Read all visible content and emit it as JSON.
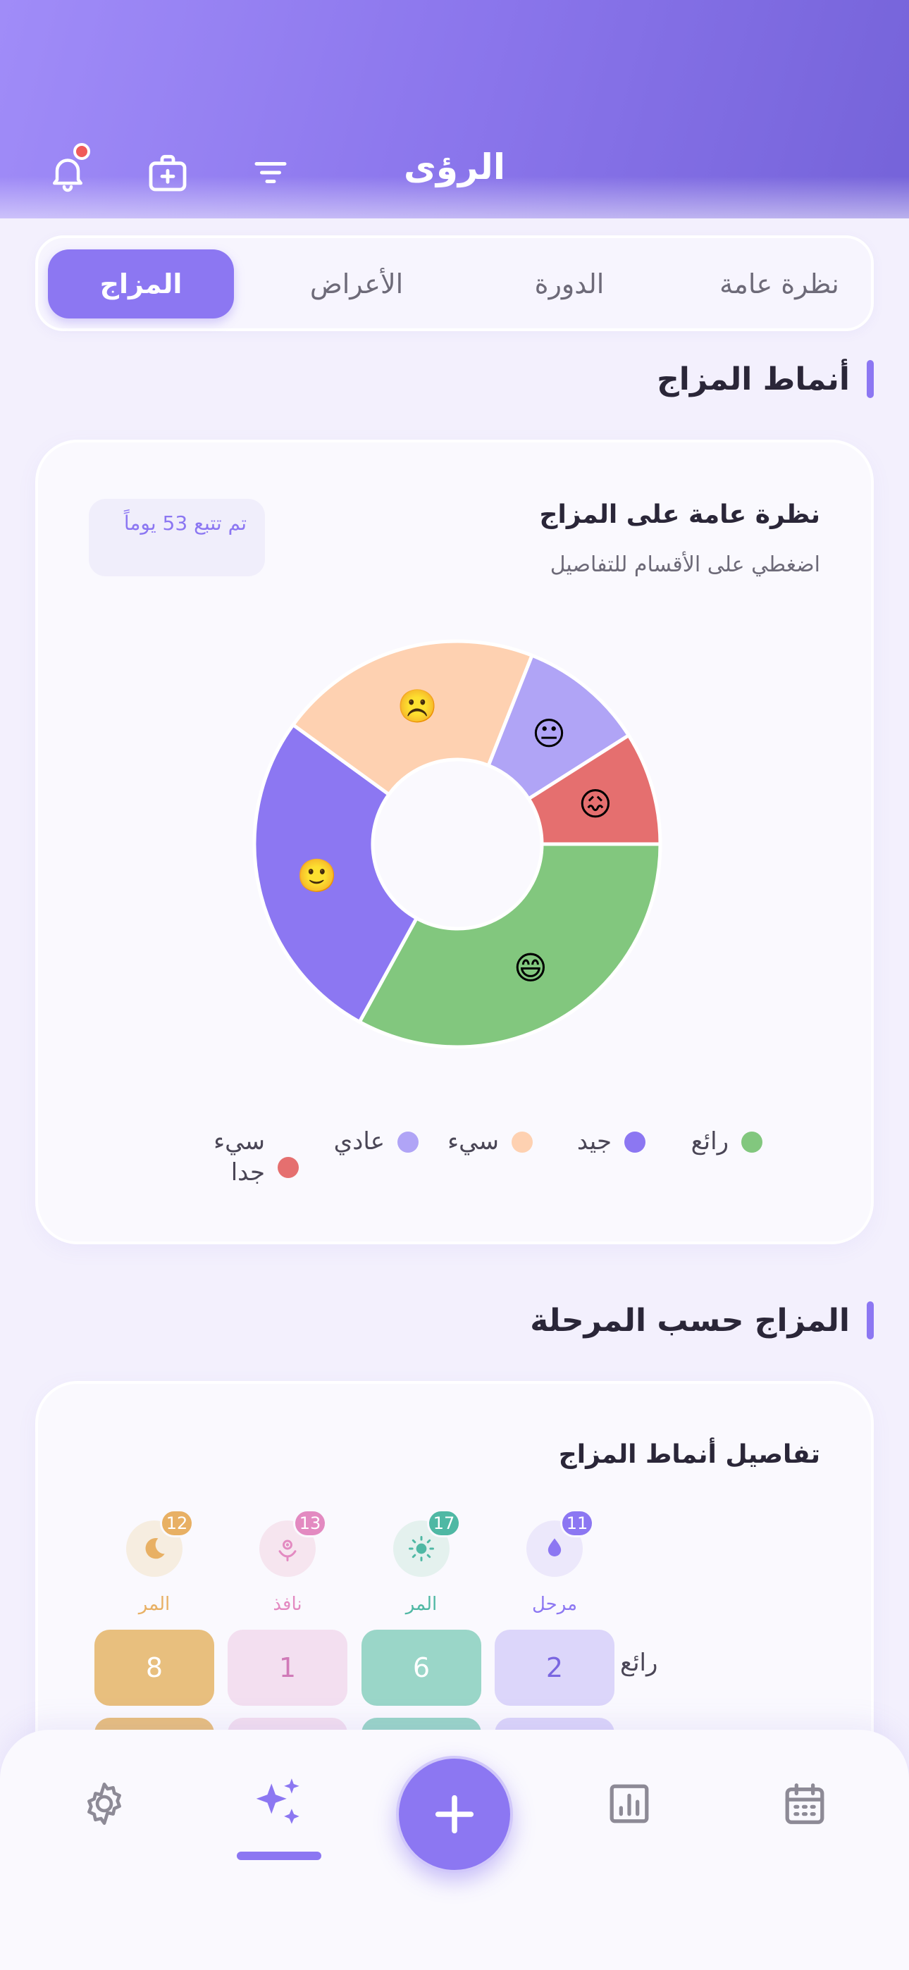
{
  "header": {
    "title": "الرؤى"
  },
  "tabs": [
    {
      "label": "نظرة عامة",
      "active": false
    },
    {
      "label": "الدورة",
      "active": false
    },
    {
      "label": "الأعراض",
      "active": false
    },
    {
      "label": "المزاج",
      "active": true
    }
  ],
  "mood_patterns": {
    "section_title": "أنماط المزاج",
    "card_title": "نظرة عامة على المزاج",
    "card_subtitle": "اضغطي على الأقسام للتفاصيل",
    "tracked_badge": "تم تتبع 53 يوماً",
    "chart_data": {
      "type": "pie",
      "donut": true,
      "start": "3 o'clock, clockwise",
      "categories": [
        "رائع",
        "جيد",
        "سيء",
        "عادي",
        "سيء جدا"
      ],
      "values": [
        33,
        27,
        21,
        10,
        9
      ],
      "colors": [
        "#82c77e",
        "#8c77f2",
        "#fed1b1",
        "#b0a4f6",
        "#e56f6f"
      ],
      "emoji": [
        "😄",
        "🙂",
        "☹️",
        "😐",
        "😖"
      ],
      "legend_position": "bottom"
    }
  },
  "mood_by_phase": {
    "section_title": "المزاج حسب المرحلة",
    "card_title": "تفاصيل أنماط المزاج",
    "phases": [
      {
        "label": "مرحل",
        "count": "11",
        "color": "#8c77f2",
        "bg": "#ece8fb",
        "icon": "drop-icon"
      },
      {
        "label": "المر",
        "count": "17",
        "color": "#4fb8a4",
        "bg": "#e4f1ee",
        "icon": "sun-icon"
      },
      {
        "label": "نافذ",
        "count": "13",
        "color": "#e38ac1",
        "bg": "#f6e5ef",
        "icon": "flower-icon"
      },
      {
        "label": "المر",
        "count": "12",
        "color": "#e8b064",
        "bg": "#f6ede0",
        "icon": "moon-icon"
      }
    ],
    "rows": [
      {
        "mood": "رائع",
        "values": [
          "2",
          "6",
          "1",
          "8"
        ]
      }
    ],
    "cell_colors": [
      {
        "bg": "#dcd6fa",
        "fg": "#7a66e0"
      },
      {
        "bg": "#9ad6c8",
        "fg": "#ffffff"
      },
      {
        "bg": "#f3dff0",
        "fg": "#d07ab8"
      },
      {
        "bg": "#e8bf7e",
        "fg": "#ffffff"
      }
    ]
  },
  "bottom_nav": {
    "items": [
      "settings",
      "insights",
      "add",
      "stats",
      "calendar"
    ],
    "active": "insights"
  }
}
